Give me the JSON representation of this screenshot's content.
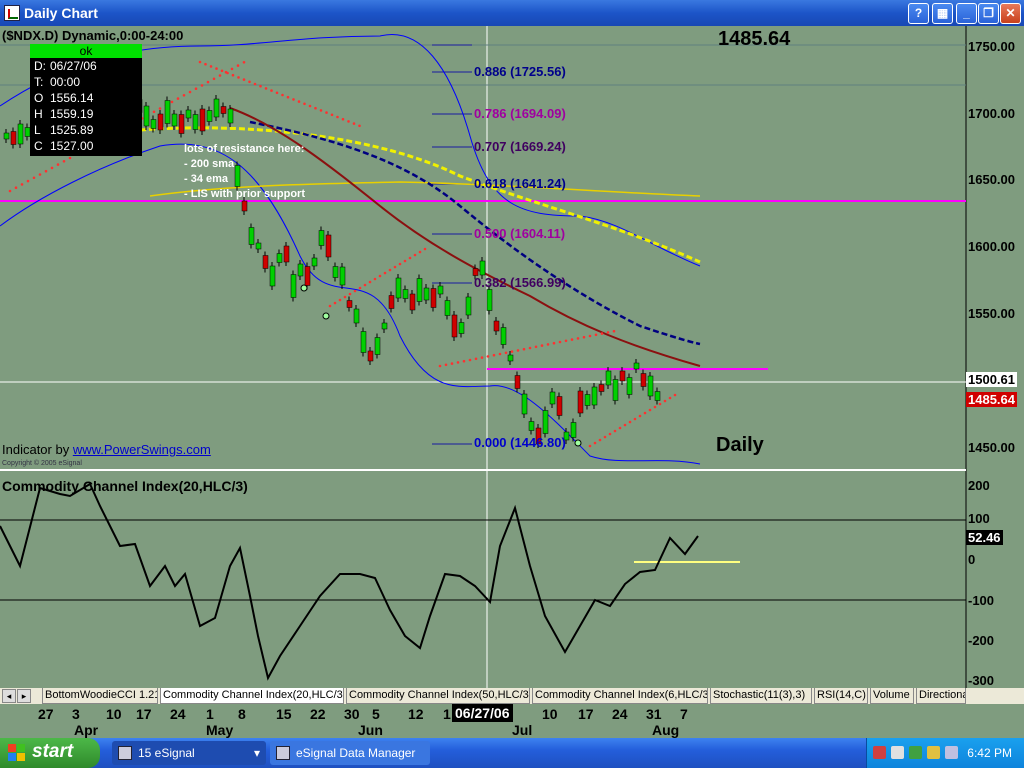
{
  "window": {
    "title": "Daily Chart",
    "buttons": {
      "help": "?",
      "minimize": "_",
      "restore": "❐",
      "close": "✕"
    }
  },
  "header": {
    "symbol_line": "($NDX.D) Dynamic,0:00-24:00",
    "last_price": "1485.64",
    "daily_label": "Daily"
  },
  "info_box": {
    "status": "ok",
    "rows": [
      {
        "k": "D:",
        "v": "06/27/06"
      },
      {
        "k": "T:",
        "v": "00:00"
      },
      {
        "k": "O",
        "v": "1556.14"
      },
      {
        "k": "H",
        "v": "1559.19"
      },
      {
        "k": "L",
        "v": "1525.89"
      },
      {
        "k": "C",
        "v": "1527.00"
      }
    ]
  },
  "annotation": {
    "lines": [
      "lots of resistance here:",
      "- 200 sma",
      "- 34 ema",
      "- LIS with prior support"
    ]
  },
  "indicator_credit": {
    "prefix": "Indicator by ",
    "link": "www.PowerSwings.com",
    "copyright": "Copyright © 2005 eSignal"
  },
  "price_axis": {
    "ticks": [
      "1750.00",
      "1700.00",
      "1650.00",
      "1600.00",
      "1550.00",
      "1500.00",
      "1450.00"
    ],
    "crosshair_tag": "1500.61",
    "last_tag": "1485.64"
  },
  "fib_levels": [
    {
      "label": "0.886 (1725.56)",
      "color": "#00008b"
    },
    {
      "label": "0.786 (1694.09)",
      "color": "#a000a0"
    },
    {
      "label": "0.707 (1669.24)",
      "color": "#400060"
    },
    {
      "label": "0.618 (1641.24)",
      "color": "#00008b"
    },
    {
      "label": "0.500 (1604.11)",
      "color": "#a000a0"
    },
    {
      "label": "0.382 (1566.99)",
      "color": "#400060"
    },
    {
      "label": "0.000 (1446.80)",
      "color": "#0000cc"
    }
  ],
  "cci": {
    "title": "Commodity Channel Index(20,HLC/3)",
    "value_tag": "52.46",
    "ticks": [
      "200",
      "100",
      "0",
      "-100",
      "-200",
      "-300"
    ]
  },
  "tabs": [
    "BottomWoodieCCI 1.21",
    "Commodity Channel Index(20,HLC/3)",
    "Commodity Channel Index(50,HLC/3)",
    "Commodity Channel Index(6,HLC/3)",
    "Stochastic(11(3),3)",
    "RSI(14,C)",
    "Volume",
    "Directiona"
  ],
  "date_axis": {
    "days": [
      "27",
      "3",
      "10",
      "17",
      "24",
      "1",
      "8",
      "15",
      "22",
      "30",
      "5",
      "12",
      "1",
      "10",
      "17",
      "24",
      "31",
      "7"
    ],
    "months": [
      "Apr",
      "May",
      "Jun",
      "Jul",
      "Aug"
    ],
    "cursor_date": "06/27/06"
  },
  "taskbar": {
    "start_label": "start",
    "tasks": [
      "15 eSignal",
      "eSignal Data Manager"
    ],
    "clock": "6:42 PM"
  },
  "colors": {
    "background": "#7f9c7f",
    "up_candle": "#00d000",
    "down_candle": "#d00000",
    "sma200": "#e8d000",
    "ema34": "#000080",
    "ma_red": "#8b1010",
    "bollinger": "#0000ff",
    "resistance_line": "#ff00ff"
  }
}
